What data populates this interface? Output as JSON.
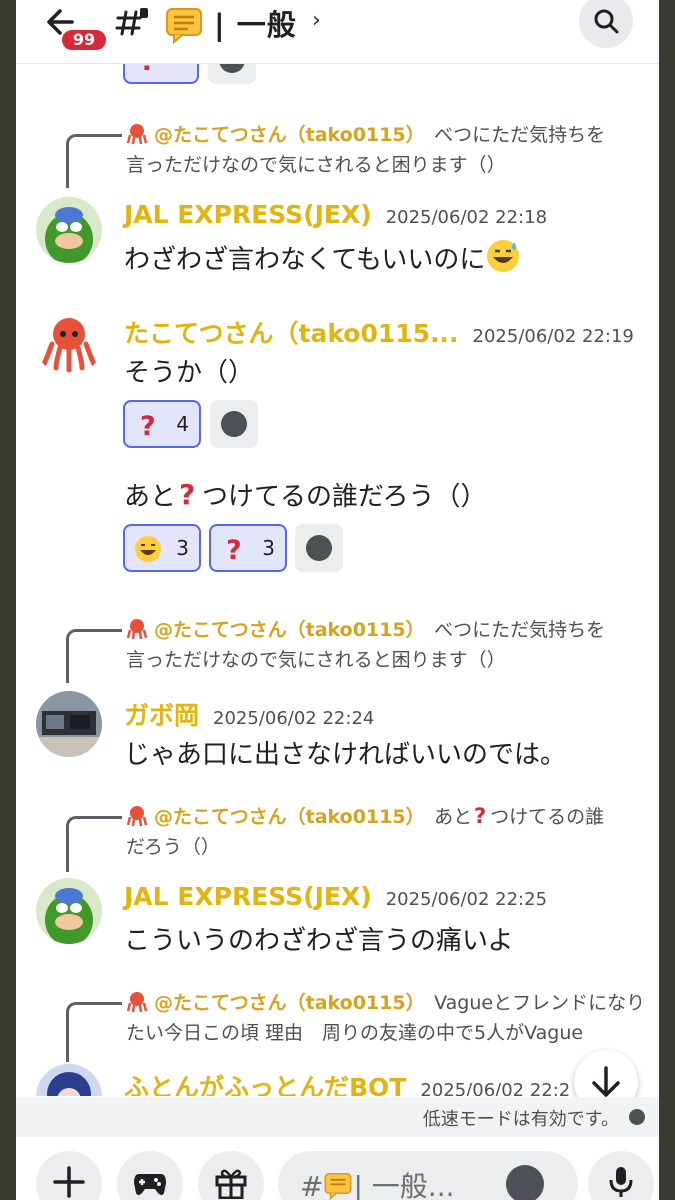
{
  "header": {
    "unread_badge": "99",
    "channel_name": "| 一般",
    "chevron": "›",
    "icons": [
      "back-arrow-icon",
      "thread-icon",
      "forum-speech-icon",
      "search-icon"
    ]
  },
  "messages": [
    {
      "reply_mention": "@たこてつさん（tako0115）",
      "reply_text_1": "べつにただ気持ちを",
      "reply_text_2": "言っただけなので気にされると困ります（）",
      "author": "JAL EXPRESS(JEX)",
      "time": "2025/06/02 22:18",
      "text": "わざわざ言わなくてもいいのに"
    },
    {
      "author": "たこてつさん（tako0115...",
      "time": "2025/06/02 22:19",
      "text": "そうか（）",
      "reactions_1": [
        {
          "emoji": "question-mark",
          "count": "4"
        }
      ],
      "text_2a": "あと",
      "text_2b": "つけてるの誰だろう（）",
      "reactions_2": [
        {
          "emoji": "sweat-smile",
          "count": "3"
        },
        {
          "emoji": "question-mark",
          "count": "3"
        }
      ]
    },
    {
      "reply_mention": "@たこてつさん（tako0115）",
      "reply_text_1": "べつにただ気持ちを",
      "reply_text_2": "言っただけなので気にされると困ります（）",
      "author": "ガボ岡",
      "time": "2025/06/02 22:24",
      "text": "じゃあ口に出さなければいいのでは。"
    },
    {
      "reply_mention": "@たこてつさん（tako0115）",
      "reply_text_1a": "あと",
      "reply_text_1b": "つけてるの誰",
      "reply_text_2": "だろう（）",
      "author": "JAL EXPRESS(JEX)",
      "time": "2025/06/02 22:25",
      "text": "こういうのわざわざ言うの痛いよ"
    },
    {
      "reply_mention": "@たこてつさん（tako0115）",
      "reply_text_1": "Vagueとフレンドになり",
      "reply_text_2": "たい今日この頃 理由　周りの友達の中で5人がVague",
      "author": "ふとんがふっとんだBOT",
      "time": "2025/06/02 22:2"
    }
  ],
  "slowmode_text": "低速モードは有効です。",
  "composer": {
    "placeholder": "#",
    "placeholder_channel": "| 一般...",
    "icons": [
      "plus-icon",
      "gamepad-icon",
      "gift-icon",
      "emoji-icon",
      "microphone-icon"
    ]
  },
  "colors": {
    "author": "#e2b40d",
    "mention": "#d7a21e",
    "reaction_border": "#5865f2",
    "reaction_bg": "#e3e5fb",
    "badge": "#d7283a"
  }
}
